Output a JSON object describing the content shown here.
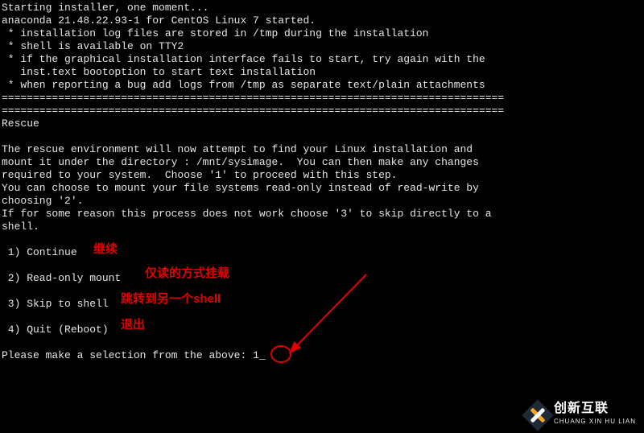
{
  "lines": {
    "l0": "Starting installer, one moment...",
    "l1": "anaconda 21.48.22.93-1 for CentOS Linux 7 started.",
    "l2": " * installation log files are stored in /tmp during the installation",
    "l3": " * shell is available on TTY2",
    "l4": " * if the graphical installation interface fails to start, try again with the",
    "l5": "   inst.text bootoption to start text installation",
    "l6": " * when reporting a bug add logs from /tmp as separate text/plain attachments",
    "sep1": "================================================================================",
    "sep2": "================================================================================",
    "l7": "Rescue",
    "l8": "",
    "l9": "The rescue environment will now attempt to find your Linux installation and",
    "l10": "mount it under the directory : /mnt/sysimage.  You can then make any changes",
    "l11": "required to your system.  Choose '1' to proceed with this step.",
    "l12": "You can choose to mount your file systems read-only instead of read-write by",
    "l13": "choosing '2'.",
    "l14": "If for some reason this process does not work choose '3' to skip directly to a",
    "l15": "shell.",
    "l16": "",
    "opt1": " 1) Continue",
    "opt2": " 2) Read-only mount",
    "opt3": " 3) Skip to shell",
    "opt4": " 4) Quit (Reboot)",
    "blank": "",
    "prompt": "Please make a selection from the above: ",
    "input": "1",
    "cursor": "_"
  },
  "annot": {
    "a1": "继续",
    "a2": "仅读的方式挂载",
    "a3": "跳转到另一个shell",
    "a4": "退出"
  },
  "watermark": {
    "cn": "创新互联",
    "py": "CHUANG XIN HU LIAN"
  }
}
